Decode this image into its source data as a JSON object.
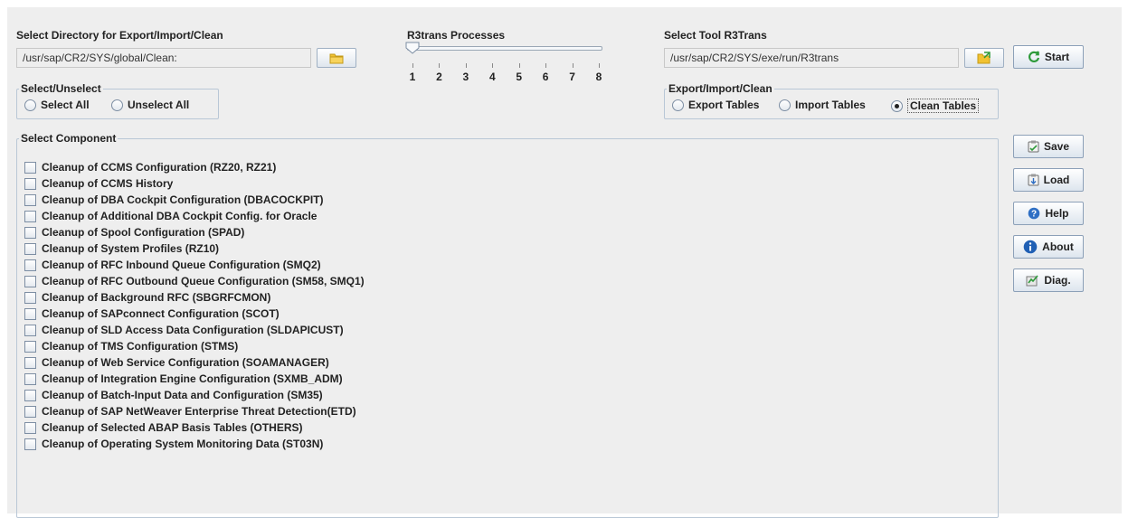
{
  "export_dir": {
    "label": "Select Directory for Export/Import/Clean",
    "value": "/usr/sap/CR2/SYS/global/Clean:",
    "browse_icon": "folder-icon"
  },
  "processes": {
    "label": "R3trans Processes",
    "min": 1,
    "max": 8,
    "value": 1,
    "ticks": [
      "1",
      "2",
      "3",
      "4",
      "5",
      "6",
      "7",
      "8"
    ]
  },
  "tool": {
    "label": "Select Tool R3Trans",
    "value": "/usr/sap/CR2/SYS/exe/run/R3trans",
    "browse_icon": "open-file-icon"
  },
  "buttons": {
    "start": "Start",
    "save": "Save",
    "load": "Load",
    "help": "Help",
    "about": "About",
    "diag": "Diag."
  },
  "select_group": {
    "title": "Select/Unselect",
    "select_all": "Select All",
    "unselect_all": "Unselect All"
  },
  "mode_group": {
    "title": "Export/Import/Clean",
    "options": [
      "Export Tables",
      "Import Tables",
      "Clean Tables"
    ],
    "selected": "Clean Tables"
  },
  "components": {
    "title": "Select Component",
    "items": [
      "Cleanup of CCMS Configuration (RZ20, RZ21)",
      "Cleanup of CCMS History",
      "Cleanup of DBA Cockpit Configuration (DBACOCKPIT)",
      "Cleanup of Additional DBA Cockpit Config. for Oracle",
      "Cleanup of Spool Configuration (SPAD)",
      "Cleanup of System Profiles (RZ10)",
      "Cleanup of RFC Inbound Queue Configuration (SMQ2)",
      "Cleanup of RFC Outbound Queue Configuration (SM58, SMQ1)",
      "Cleanup of Background RFC (SBGRFCMON)",
      "Cleanup of SAPconnect Configuration (SCOT)",
      "Cleanup of SLD Access Data Configuration (SLDAPICUST)",
      "Cleanup of TMS Configuration (STMS)",
      "Cleanup of Web Service Configuration (SOAMANAGER)",
      "Cleanup of Integration Engine Configuration (SXMB_ADM)",
      "Cleanup of Batch-Input Data and Configuration (SM35)",
      "Cleanup of SAP NetWeaver Enterprise Threat Detection(ETD)",
      "Cleanup of Selected ABAP Basis Tables (OTHERS)",
      "Cleanup of Operating System Monitoring Data (ST03N)"
    ]
  },
  "colors": {
    "panel_bg": "#eeeeee",
    "border": "#b9c7d6",
    "start_icon": "#2e9a3a",
    "help_icon": "#2f6fc4",
    "folder": "#f1c232"
  }
}
